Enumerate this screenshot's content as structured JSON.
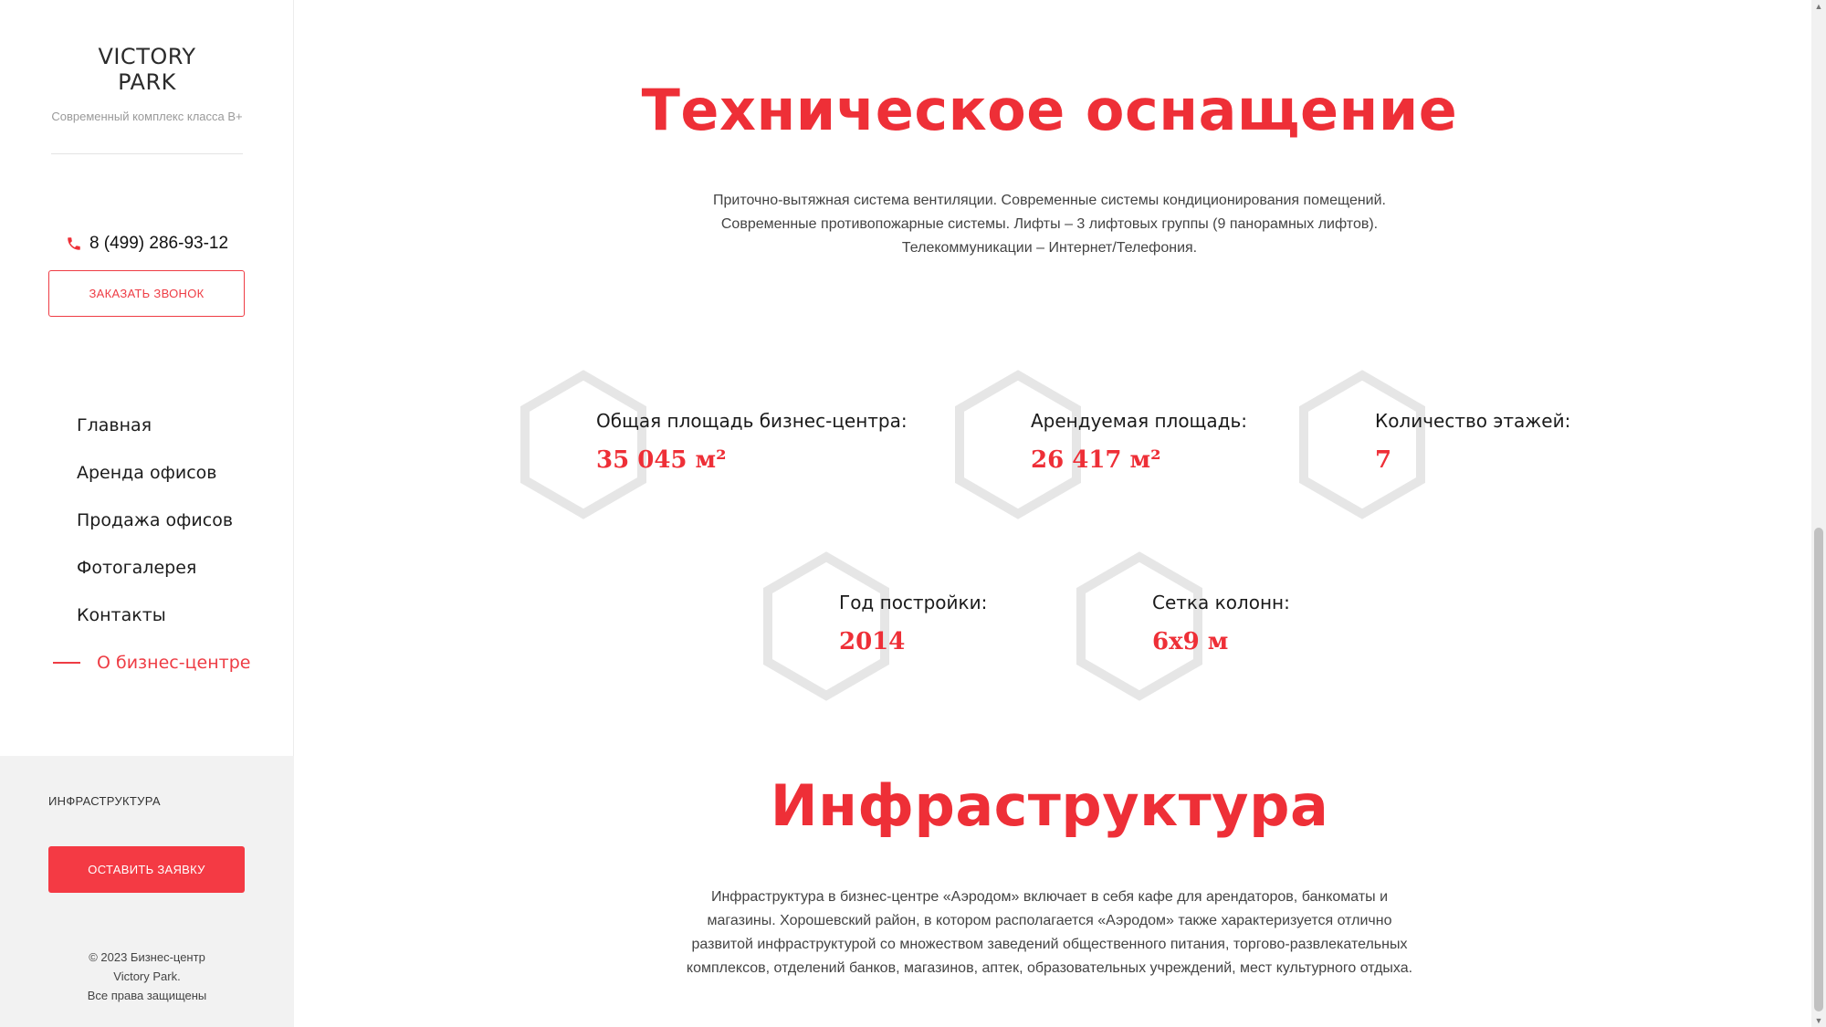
{
  "sidebar": {
    "brand": {
      "line1": "VICTORY",
      "line2": "PARK",
      "subtitle": "Современный комплекс класса В+"
    },
    "phone": {
      "icon": "phone-icon",
      "number": "8 (499) 286-93-12"
    },
    "callback_label": "ЗАКАЗАТЬ ЗВОНОК",
    "nav": [
      {
        "label": "Главная",
        "active": false
      },
      {
        "label": "Аренда офисов",
        "active": false
      },
      {
        "label": "Продажа офисов",
        "active": false
      },
      {
        "label": "Фотогалерея",
        "active": false
      },
      {
        "label": "Контакты",
        "active": false
      },
      {
        "label": "О бизнес-центре",
        "active": true
      }
    ],
    "infra_link": "ИНФРАСТРУКТУРА",
    "apply_label": "ОСТАВИТЬ ЗАЯВКУ",
    "copyright": {
      "line1": "© 2023 Бизнес-центр",
      "line2": "Victory Park.",
      "line3": "Все права защищены"
    }
  },
  "main": {
    "tech": {
      "title": "Техническое оснащение",
      "text": [
        "Приточно-вытяжная система вентиляции. Современные системы кондиционирования помещений.",
        "Современные противопожарные системы. Лифты – 3 лифтовых группы (9 панорамных лифтов).",
        "Телекоммуникации – Интернет/Телефония."
      ]
    },
    "stats": [
      {
        "label": "Общая площадь бизнес-центра:",
        "value": "35 045 м²"
      },
      {
        "label": "Арендуемая площадь:",
        "value": "26 417 м²"
      },
      {
        "label": "Количество этажей:",
        "value": "7"
      },
      {
        "label": "Год постройки:",
        "value": "2014"
      },
      {
        "label": "Сетка колонн:",
        "value": "6х9 м"
      }
    ],
    "infra": {
      "title": "Инфраструктура",
      "text": [
        "Инфраструктура в бизнес-центре «Аэродом» включает в себя кафе для арендаторов, банкоматы и",
        "магазины. Хорошевский район, в котором располагается «Аэродом» также характеризуется отлично",
        "развитой инфраструктурой со множеством заведений общественного питания, торгово-развлекательных",
        "комплексов, отделений банков, магазинов, аптек, образовательных учреждений, мест культурного отдыха."
      ]
    }
  },
  "colors": {
    "accent": "#ee2f37",
    "hex_outline": "#e6e6e6",
    "sidebar_bottom": "#f2f2f2"
  }
}
